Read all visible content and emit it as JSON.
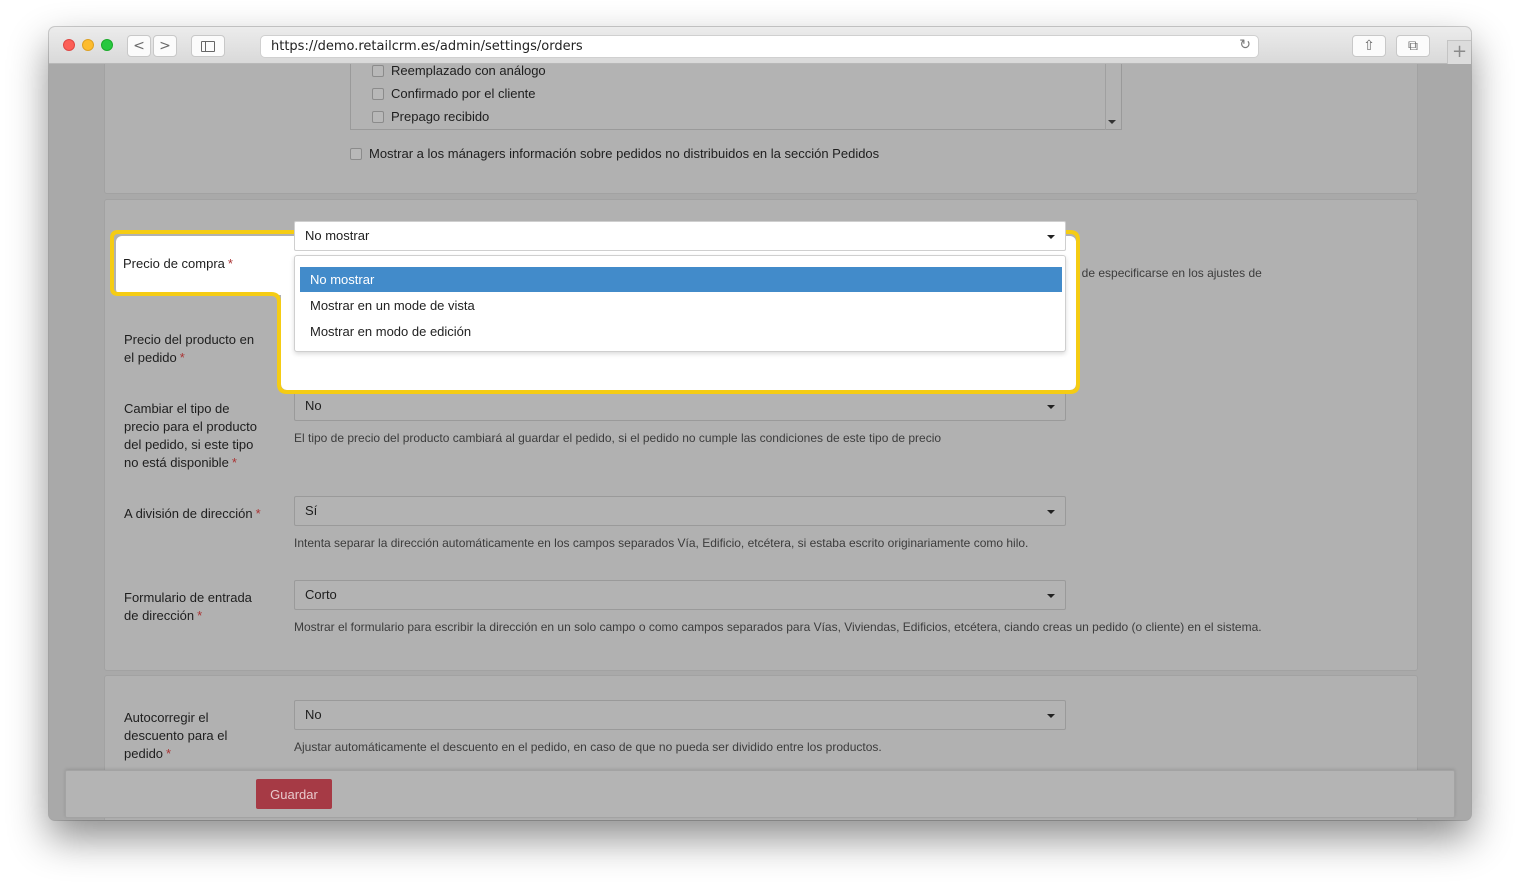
{
  "browser": {
    "url": "https://demo.retailcrm.es/admin/settings/orders",
    "nav_back": "<",
    "nav_forward": ">",
    "reload_glyph": "↻",
    "share_glyph": "⇧",
    "tabs_glyph": "⧉",
    "newtab_glyph": "+"
  },
  "status_list": {
    "items": [
      "Reemplazado con análogo",
      "Confirmado por el cliente",
      "Prepago recibido"
    ]
  },
  "manager_info_checkbox": "Mostrar a los mánagers información sobre pedidos no distribuidos en la sección Pedidos",
  "purchase_price": {
    "label": "Precio de compra",
    "required": "*",
    "selected": "No mostrar",
    "options": [
      "No mostrar",
      "Mostrar en un mode de vista",
      "Mostrar en modo de edición"
    ],
    "help_fragment": "ue de especificarse en los ajustes de"
  },
  "product_price": {
    "label_line1": "Precio del producto en",
    "label_line2": "el pedido",
    "required": "*"
  },
  "change_price_type": {
    "label_lines": [
      "Cambiar el tipo de",
      "precio para el producto",
      "del pedido, si este tipo",
      "no está disponible"
    ],
    "required": "*",
    "value": "No",
    "help": "El tipo de precio del producto cambiará al guardar el pedido, si el pedido no cumple las condiciones de este tipo de precio"
  },
  "address_split": {
    "label": "A división de dirección",
    "required": "*",
    "value": "Sí",
    "help": "Intenta separar la dirección automáticamente en los campos separados Vía, Edificio, etcétera, si estaba escrito originariamente como hilo."
  },
  "address_form": {
    "label_line1": "Formulario de entrada",
    "label_line2": "de dirección",
    "required": "*",
    "value": "Corto",
    "help": "Mostrar el formulario para escribir la dirección en un solo campo o como campos separados para Vías, Viviendas, Edificios, etcétera, ciando creas un pedido (o cliente) en el sistema."
  },
  "autocorrect_discount": {
    "label_lines": [
      "Autocorregir el",
      "descuento para el",
      "pedido"
    ],
    "required": "*",
    "value": "No",
    "help": "Ajustar automáticamente el descuento en el pedido, en caso de que no pueda ser dividido entre los productos."
  },
  "footer": {
    "save_label": "Guardar"
  },
  "colors": {
    "highlight_border": "#f5cc14",
    "active_option": "#428bca",
    "save_button": "#a63a45"
  }
}
